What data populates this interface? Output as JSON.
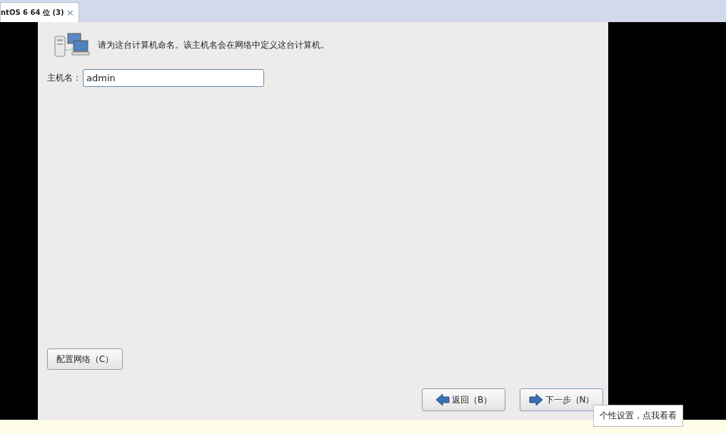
{
  "tab": {
    "title": "ntOS 6 64 位 (3)",
    "close": "×",
    "selected": true
  },
  "installer": {
    "prompt": "请为这台计算机命名。该主机名会在网络中定义这台计算机。",
    "hostname": {
      "label": "主机名：",
      "value": "admin"
    },
    "configure_network": "配置网络（C）",
    "buttons": [
      {
        "kind": "back",
        "label": "返回（B）",
        "focused": false
      },
      {
        "kind": "next",
        "label": "下一步（N）",
        "focused": true
      }
    ]
  },
  "tooltip": "个性设置，点我看看"
}
